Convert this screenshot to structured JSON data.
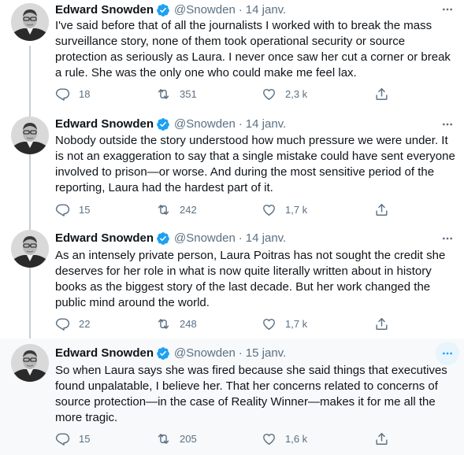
{
  "colors": {
    "name": "#0f1419",
    "secondary": "#5b7083",
    "verified": "#1da1f2",
    "thread_line": "#c4cfd6",
    "hover_bg": "#f7f9fa"
  },
  "icons": [
    "verified-badge-icon",
    "more-icon",
    "reply-icon",
    "retweet-icon",
    "like-icon",
    "share-icon"
  ],
  "tweets": [
    {
      "name": "Edward Snowden",
      "handle": "@Snowden",
      "separator": "·",
      "date": "14 janv.",
      "text": "I've said before that of all the journalists I worked with to break the mass surveillance story, none of them took operational security or source protection as seriously as Laura. I never once saw her cut a corner or break a rule. She was the only one who could make me feel lax.",
      "replies": "18",
      "retweets": "351",
      "likes": "2,3 k"
    },
    {
      "name": "Edward Snowden",
      "handle": "@Snowden",
      "separator": "·",
      "date": "14 janv.",
      "text": "Nobody outside the story understood how much pressure we were under. It is not an exaggeration to say that a single mistake could have sent everyone involved to prison—or worse. And during the most sensitive period of the reporting, Laura had the hardest part of it.",
      "replies": "15",
      "retweets": "242",
      "likes": "1,7 k"
    },
    {
      "name": "Edward Snowden",
      "handle": "@Snowden",
      "separator": "·",
      "date": "14 janv.",
      "text": "As an intensely private person, Laura Poitras has not sought the credit she deserves for her role in what is now quite literally written about in history books as the biggest story of the last decade. But her work changed the public mind around the world.",
      "replies": "22",
      "retweets": "248",
      "likes": "1,7 k"
    },
    {
      "name": "Edward Snowden",
      "handle": "@Snowden",
      "separator": "·",
      "date": "15 janv.",
      "text": "So when Laura says she was fired because she said things that executives found unpalatable, I believe her. That her concerns related to concerns of source protection—in the case of Reality Winner—makes it for me all the more tragic.",
      "replies": "15",
      "retweets": "205",
      "likes": "1,6 k"
    }
  ]
}
